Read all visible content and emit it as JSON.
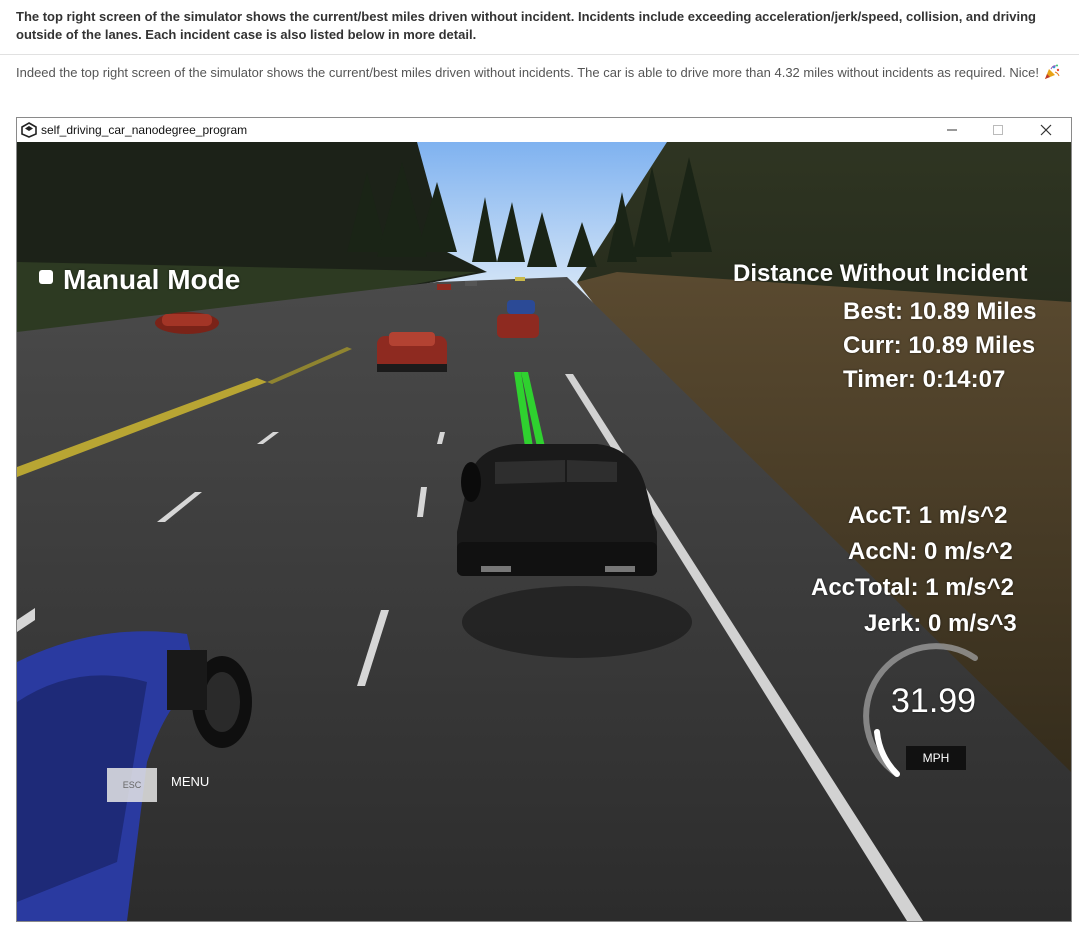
{
  "article": {
    "paragraph_1": "The top right screen of the simulator shows the current/best miles driven without incident. Incidents include exceeding acceleration/jerk/speed, collision, and driving outside of the lanes. Each incident case is also listed below in more detail.",
    "paragraph_2": "Indeed the top right screen of the simulator shows the current/best miles driven without incidents. The car is able to drive more than 4.32 miles without incidents as required. Nice!"
  },
  "window": {
    "title": "self_driving_car_nanodegree_program"
  },
  "hud": {
    "mode": "Manual Mode",
    "distance_title": "Distance Without Incident",
    "best": "Best: 10.89 Miles",
    "curr": "Curr: 10.89 Miles",
    "timer": "Timer: 0:14:07",
    "acc_t": "AccT: 1 m/s^2",
    "acc_n": "AccN: 0 m/s^2",
    "acc_total": "AccTotal: 1 m/s^2",
    "jerk": "Jerk: 0 m/s^3",
    "speed": "31.99",
    "speed_unit": "MPH",
    "esc_label": "ESC",
    "menu_label": "MENU"
  }
}
